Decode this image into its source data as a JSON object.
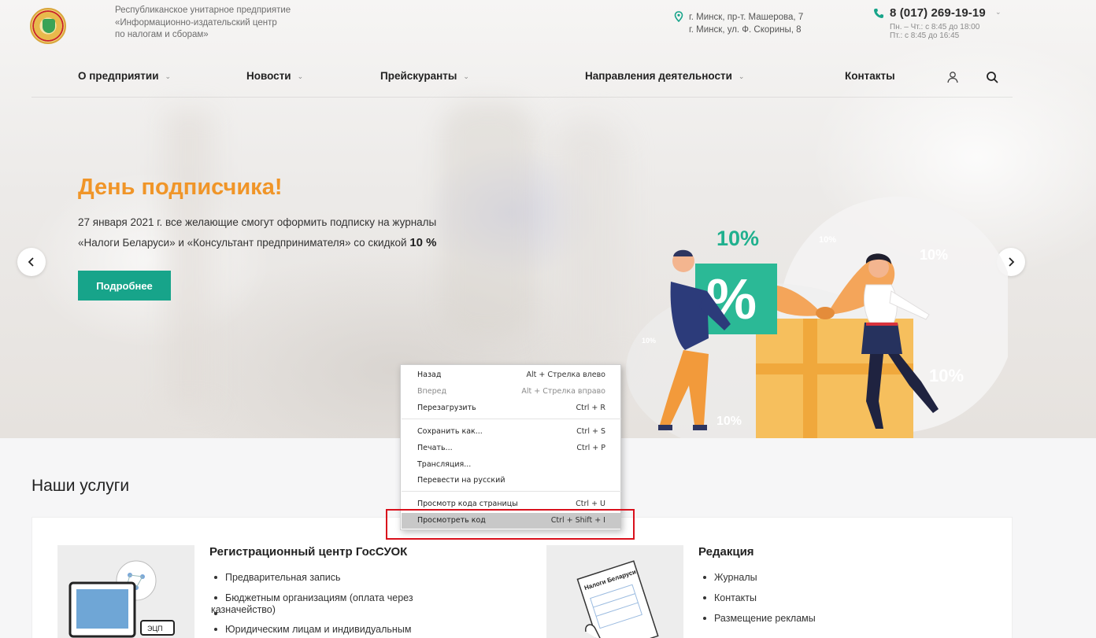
{
  "header": {
    "org_line1": "Республиканское унитарное предприятие",
    "org_line2": "«Информационно-издательский центр",
    "org_line3": "по налогам и сборам»",
    "address_line1": "г. Минск, пр-т. Машерова, 7",
    "address_line2": "г. Минск, ул. Ф. Скорины, 8",
    "phone": "8 (017) 269-19-19",
    "hours_line1": "Пн. – Чт.: с 8:45 до 18:00",
    "hours_line2": "Пт.: с 8:45 до 16:45"
  },
  "nav": {
    "items": [
      {
        "label": "О предприятии"
      },
      {
        "label": "Новости"
      },
      {
        "label": "Прейскуранты"
      },
      {
        "label": "Направления деятельности"
      },
      {
        "label": "Контакты"
      }
    ]
  },
  "banner": {
    "title": "День подписчика!",
    "text_line1": "27 января 2021 г. все желающие смогут оформить подписку на журналы",
    "text_line2": "«Налоги Беларуси» и «Консультант предпринимателя» со скидкой ",
    "discount": "10 %",
    "button": "Подробнее",
    "illus_big": "10%",
    "illus_pct": "%",
    "illus_small": "10%"
  },
  "services": {
    "title": "Наши услуги",
    "card1": {
      "title": "Регистрационный центр ГосСУОК",
      "items": [
        "Предварительная запись",
        "Бюджетным организациям (оплата через",
        "казначейство)",
        "Юридическим лицам и индивидуальным"
      ],
      "tag": "ЭЦП"
    },
    "card2": {
      "title": "Редакция",
      "items": [
        "Журналы",
        "Контакты",
        "Размещение рекламы"
      ],
      "doc_title": "Налоги Беларуси"
    }
  },
  "context_menu": {
    "items": [
      {
        "label": "Назад",
        "shortcut": "Alt + Стрелка влево"
      },
      {
        "label": "Вперед",
        "shortcut": "Alt + Стрелка вправо"
      },
      {
        "label": "Перезагрузить",
        "shortcut": "Ctrl + R"
      },
      {
        "label": "Сохранить как...",
        "shortcut": "Ctrl + S"
      },
      {
        "label": "Печать...",
        "shortcut": "Ctrl + P"
      },
      {
        "label": "Трансляция...",
        "shortcut": ""
      },
      {
        "label": "Перевести на русский",
        "shortcut": ""
      },
      {
        "label": "Просмотр кода страницы",
        "shortcut": "Ctrl + U"
      },
      {
        "label": "Просмотреть код",
        "shortcut": "Ctrl + Shift + I"
      }
    ]
  },
  "colors": {
    "accent_orange": "#f09528",
    "accent_teal": "#17a48a",
    "highlight_red": "#d9101c"
  }
}
